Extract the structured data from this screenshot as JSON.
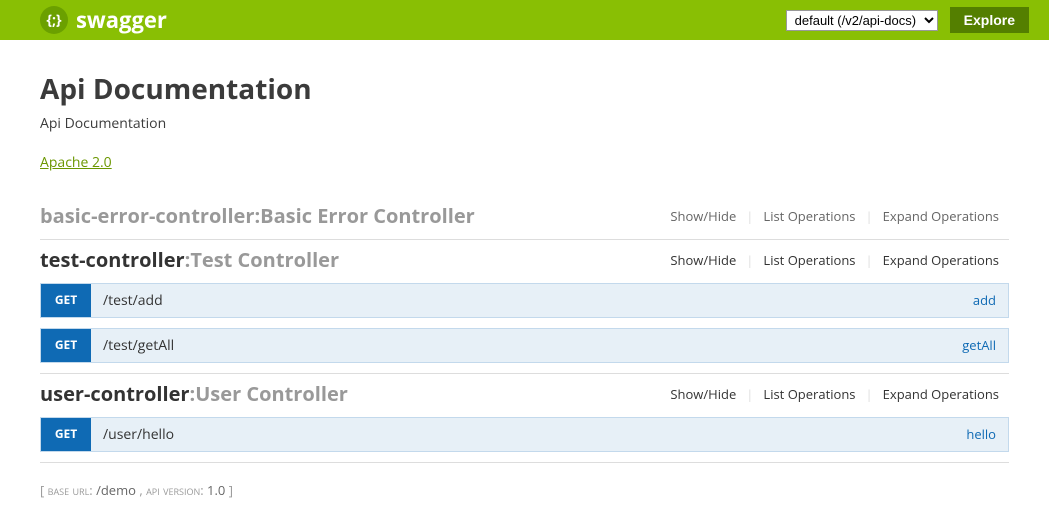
{
  "header": {
    "logo_text": "swagger",
    "api_spec": "default (/v2/api-docs)",
    "explore_label": "Explore"
  },
  "info": {
    "title": "Api Documentation",
    "description": "Api Documentation",
    "license": "Apache 2.0",
    "base_url_label": "base url",
    "base_url": "/demo",
    "api_version_label": "api version",
    "api_version": "1.0"
  },
  "op_links": {
    "show_hide": "Show/Hide",
    "list_ops": "List Operations",
    "expand_ops": "Expand Operations"
  },
  "controllers": [
    {
      "name": "basic-error-controller",
      "description": "Basic Error Controller",
      "expanded": false,
      "operations": []
    },
    {
      "name": "test-controller",
      "description": "Test Controller",
      "expanded": true,
      "operations": [
        {
          "method": "GET",
          "path": "/test/add",
          "name": "add"
        },
        {
          "method": "GET",
          "path": "/test/getAll",
          "name": "getAll"
        }
      ]
    },
    {
      "name": "user-controller",
      "description": "User Controller",
      "expanded": true,
      "operations": [
        {
          "method": "GET",
          "path": "/user/hello",
          "name": "hello"
        }
      ]
    }
  ],
  "colors": {
    "brand_green": "#89bf04",
    "get_blue": "#0f6ab4",
    "op_bg": "#e7f0f7",
    "op_border": "#c3d9ec"
  }
}
